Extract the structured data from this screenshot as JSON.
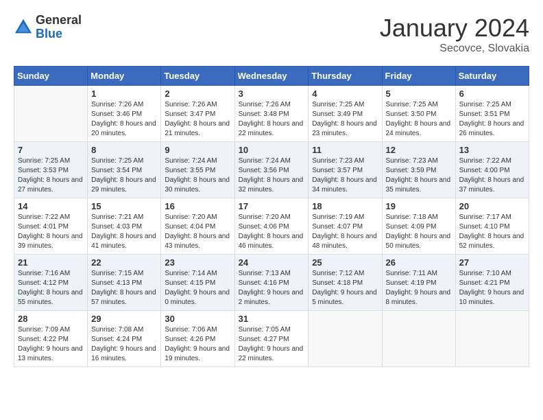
{
  "header": {
    "logo_general": "General",
    "logo_blue": "Blue",
    "month_title": "January 2024",
    "location": "Secovce, Slovakia"
  },
  "weekdays": [
    "Sunday",
    "Monday",
    "Tuesday",
    "Wednesday",
    "Thursday",
    "Friday",
    "Saturday"
  ],
  "weeks": [
    [
      {
        "day": "",
        "sunrise": "",
        "sunset": "",
        "daylight": ""
      },
      {
        "day": "1",
        "sunrise": "Sunrise: 7:26 AM",
        "sunset": "Sunset: 3:46 PM",
        "daylight": "Daylight: 8 hours and 20 minutes."
      },
      {
        "day": "2",
        "sunrise": "Sunrise: 7:26 AM",
        "sunset": "Sunset: 3:47 PM",
        "daylight": "Daylight: 8 hours and 21 minutes."
      },
      {
        "day": "3",
        "sunrise": "Sunrise: 7:26 AM",
        "sunset": "Sunset: 3:48 PM",
        "daylight": "Daylight: 8 hours and 22 minutes."
      },
      {
        "day": "4",
        "sunrise": "Sunrise: 7:25 AM",
        "sunset": "Sunset: 3:49 PM",
        "daylight": "Daylight: 8 hours and 23 minutes."
      },
      {
        "day": "5",
        "sunrise": "Sunrise: 7:25 AM",
        "sunset": "Sunset: 3:50 PM",
        "daylight": "Daylight: 8 hours and 24 minutes."
      },
      {
        "day": "6",
        "sunrise": "Sunrise: 7:25 AM",
        "sunset": "Sunset: 3:51 PM",
        "daylight": "Daylight: 8 hours and 26 minutes."
      }
    ],
    [
      {
        "day": "7",
        "sunrise": "Sunrise: 7:25 AM",
        "sunset": "Sunset: 3:53 PM",
        "daylight": "Daylight: 8 hours and 27 minutes."
      },
      {
        "day": "8",
        "sunrise": "Sunrise: 7:25 AM",
        "sunset": "Sunset: 3:54 PM",
        "daylight": "Daylight: 8 hours and 29 minutes."
      },
      {
        "day": "9",
        "sunrise": "Sunrise: 7:24 AM",
        "sunset": "Sunset: 3:55 PM",
        "daylight": "Daylight: 8 hours and 30 minutes."
      },
      {
        "day": "10",
        "sunrise": "Sunrise: 7:24 AM",
        "sunset": "Sunset: 3:56 PM",
        "daylight": "Daylight: 8 hours and 32 minutes."
      },
      {
        "day": "11",
        "sunrise": "Sunrise: 7:23 AM",
        "sunset": "Sunset: 3:57 PM",
        "daylight": "Daylight: 8 hours and 34 minutes."
      },
      {
        "day": "12",
        "sunrise": "Sunrise: 7:23 AM",
        "sunset": "Sunset: 3:59 PM",
        "daylight": "Daylight: 8 hours and 35 minutes."
      },
      {
        "day": "13",
        "sunrise": "Sunrise: 7:22 AM",
        "sunset": "Sunset: 4:00 PM",
        "daylight": "Daylight: 8 hours and 37 minutes."
      }
    ],
    [
      {
        "day": "14",
        "sunrise": "Sunrise: 7:22 AM",
        "sunset": "Sunset: 4:01 PM",
        "daylight": "Daylight: 8 hours and 39 minutes."
      },
      {
        "day": "15",
        "sunrise": "Sunrise: 7:21 AM",
        "sunset": "Sunset: 4:03 PM",
        "daylight": "Daylight: 8 hours and 41 minutes."
      },
      {
        "day": "16",
        "sunrise": "Sunrise: 7:20 AM",
        "sunset": "Sunset: 4:04 PM",
        "daylight": "Daylight: 8 hours and 43 minutes."
      },
      {
        "day": "17",
        "sunrise": "Sunrise: 7:20 AM",
        "sunset": "Sunset: 4:06 PM",
        "daylight": "Daylight: 8 hours and 46 minutes."
      },
      {
        "day": "18",
        "sunrise": "Sunrise: 7:19 AM",
        "sunset": "Sunset: 4:07 PM",
        "daylight": "Daylight: 8 hours and 48 minutes."
      },
      {
        "day": "19",
        "sunrise": "Sunrise: 7:18 AM",
        "sunset": "Sunset: 4:09 PM",
        "daylight": "Daylight: 8 hours and 50 minutes."
      },
      {
        "day": "20",
        "sunrise": "Sunrise: 7:17 AM",
        "sunset": "Sunset: 4:10 PM",
        "daylight": "Daylight: 8 hours and 52 minutes."
      }
    ],
    [
      {
        "day": "21",
        "sunrise": "Sunrise: 7:16 AM",
        "sunset": "Sunset: 4:12 PM",
        "daylight": "Daylight: 8 hours and 55 minutes."
      },
      {
        "day": "22",
        "sunrise": "Sunrise: 7:15 AM",
        "sunset": "Sunset: 4:13 PM",
        "daylight": "Daylight: 8 hours and 57 minutes."
      },
      {
        "day": "23",
        "sunrise": "Sunrise: 7:14 AM",
        "sunset": "Sunset: 4:15 PM",
        "daylight": "Daylight: 9 hours and 0 minutes."
      },
      {
        "day": "24",
        "sunrise": "Sunrise: 7:13 AM",
        "sunset": "Sunset: 4:16 PM",
        "daylight": "Daylight: 9 hours and 2 minutes."
      },
      {
        "day": "25",
        "sunrise": "Sunrise: 7:12 AM",
        "sunset": "Sunset: 4:18 PM",
        "daylight": "Daylight: 9 hours and 5 minutes."
      },
      {
        "day": "26",
        "sunrise": "Sunrise: 7:11 AM",
        "sunset": "Sunset: 4:19 PM",
        "daylight": "Daylight: 9 hours and 8 minutes."
      },
      {
        "day": "27",
        "sunrise": "Sunrise: 7:10 AM",
        "sunset": "Sunset: 4:21 PM",
        "daylight": "Daylight: 9 hours and 10 minutes."
      }
    ],
    [
      {
        "day": "28",
        "sunrise": "Sunrise: 7:09 AM",
        "sunset": "Sunset: 4:22 PM",
        "daylight": "Daylight: 9 hours and 13 minutes."
      },
      {
        "day": "29",
        "sunrise": "Sunrise: 7:08 AM",
        "sunset": "Sunset: 4:24 PM",
        "daylight": "Daylight: 9 hours and 16 minutes."
      },
      {
        "day": "30",
        "sunrise": "Sunrise: 7:06 AM",
        "sunset": "Sunset: 4:26 PM",
        "daylight": "Daylight: 9 hours and 19 minutes."
      },
      {
        "day": "31",
        "sunrise": "Sunrise: 7:05 AM",
        "sunset": "Sunset: 4:27 PM",
        "daylight": "Daylight: 9 hours and 22 minutes."
      },
      {
        "day": "",
        "sunrise": "",
        "sunset": "",
        "daylight": ""
      },
      {
        "day": "",
        "sunrise": "",
        "sunset": "",
        "daylight": ""
      },
      {
        "day": "",
        "sunrise": "",
        "sunset": "",
        "daylight": ""
      }
    ]
  ]
}
